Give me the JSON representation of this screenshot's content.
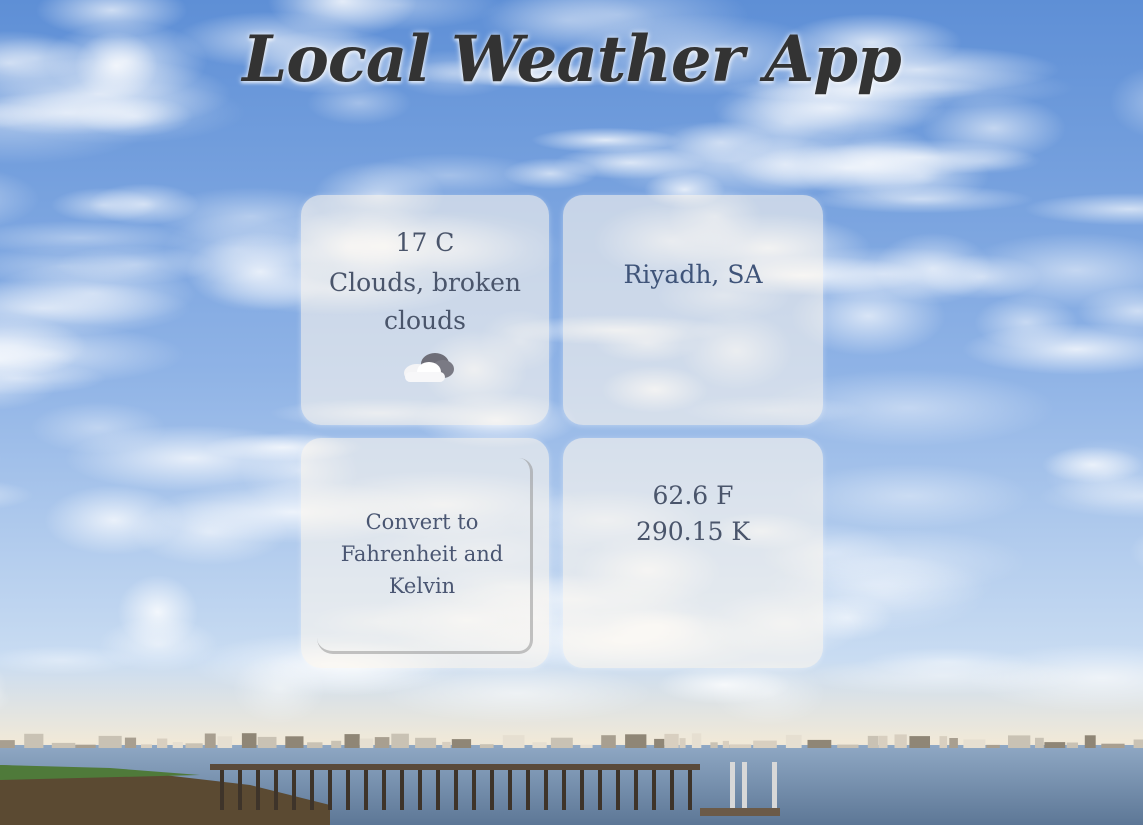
{
  "app": {
    "title": "Local Weather App"
  },
  "weather": {
    "temperature": "17 C",
    "condition": "Clouds, broken clouds",
    "icon": "broken-clouds-icon"
  },
  "location": {
    "name": "Riyadh, SA"
  },
  "conversion": {
    "button_label": "Convert to Fahrenheit and Kelvin",
    "fahrenheit": "62.6 F",
    "kelvin": "290.15 K"
  },
  "colors": {
    "card_background": "#fff8ee",
    "title_text": "#333333",
    "card_text": "#4a556b",
    "location_text": "#3f5479"
  }
}
